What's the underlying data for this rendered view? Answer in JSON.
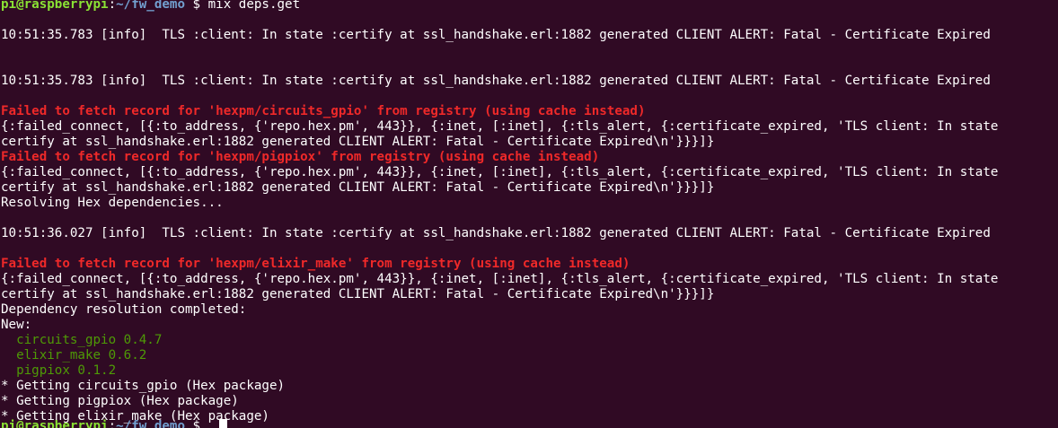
{
  "prompt": {
    "user_host": "pi@raspberrypi",
    "separator": ":",
    "path": "~/fw_demo",
    "symbol": " $ ",
    "command": "mix deps.get"
  },
  "lines": [
    {
      "text": "10:51:35.783 [info]  TLS :client: In state :certify at ssl_handshake.erl:1882 generated CLIENT ALERT: Fatal - Certificate Expired",
      "kind": "white"
    },
    {
      "text": "10:51:35.783 [info]  TLS :client: In state :certify at ssl_handshake.erl:1882 generated CLIENT ALERT: Fatal - Certificate Expired",
      "kind": "white"
    },
    {
      "text": "Failed to fetch record for 'hexpm/circuits_gpio' from registry (using cache instead)",
      "kind": "red"
    },
    {
      "text": "{:failed_connect, [{:to_address, {'repo.hex.pm', 443}}, {:inet, [:inet], {:tls_alert, {:certificate_expired, 'TLS client: In state",
      "kind": "white"
    },
    {
      "text": "certify at ssl_handshake.erl:1882 generated CLIENT ALERT: Fatal - Certificate Expired\\n'}}}]}",
      "kind": "white"
    },
    {
      "text": "Failed to fetch record for 'hexpm/pigpiox' from registry (using cache instead)",
      "kind": "red"
    },
    {
      "text": "{:failed_connect, [{:to_address, {'repo.hex.pm', 443}}, {:inet, [:inet], {:tls_alert, {:certificate_expired, 'TLS client: In state",
      "kind": "white"
    },
    {
      "text": "certify at ssl_handshake.erl:1882 generated CLIENT ALERT: Fatal - Certificate Expired\\n'}}}]}",
      "kind": "white"
    },
    {
      "text": "Resolving Hex dependencies...",
      "kind": "white"
    },
    {
      "text": "10:51:36.027 [info]  TLS :client: In state :certify at ssl_handshake.erl:1882 generated CLIENT ALERT: Fatal - Certificate Expired",
      "kind": "white"
    },
    {
      "text": "Failed to fetch record for 'hexpm/elixir_make' from registry (using cache instead)",
      "kind": "red"
    },
    {
      "text": "{:failed_connect, [{:to_address, {'repo.hex.pm', 443}}, {:inet, [:inet], {:tls_alert, {:certificate_expired, 'TLS client: In state",
      "kind": "white"
    },
    {
      "text": "certify at ssl_handshake.erl:1882 generated CLIENT ALERT: Fatal - Certificate Expired\\n'}}}]}",
      "kind": "white"
    },
    {
      "text": "Dependency resolution completed:",
      "kind": "white"
    },
    {
      "text": "New:",
      "kind": "white"
    },
    {
      "text": "  circuits_gpio 0.4.7",
      "kind": "green"
    },
    {
      "text": "  elixir_make 0.6.2",
      "kind": "green"
    },
    {
      "text": "  pigpiox 0.1.2",
      "kind": "green"
    },
    {
      "text": "* Getting circuits_gpio (Hex package)",
      "kind": "white"
    },
    {
      "text": "* Getting pigpiox (Hex package)",
      "kind": "white"
    },
    {
      "text": "* Getting elixir_make (Hex package)",
      "kind": "white"
    }
  ]
}
